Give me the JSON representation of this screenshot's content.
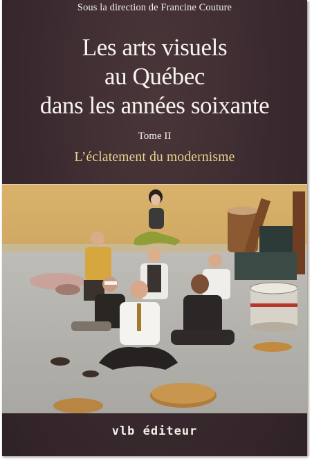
{
  "cover": {
    "director_line": "Sous la direction de Francine Couture",
    "title_lines": [
      "Les arts visuels",
      "au Québec",
      "dans les années soixante"
    ],
    "tome": "Tome II",
    "subtitle": "L’éclatement du modernisme",
    "publisher": "vlb éditeur"
  },
  "colors": {
    "background": "#3a2a2f",
    "title_text": "#f7f4ee",
    "subtitle_text": "#ead28c",
    "photo_wall": "#d8b46c",
    "photo_floor": "#b4b2ad"
  }
}
